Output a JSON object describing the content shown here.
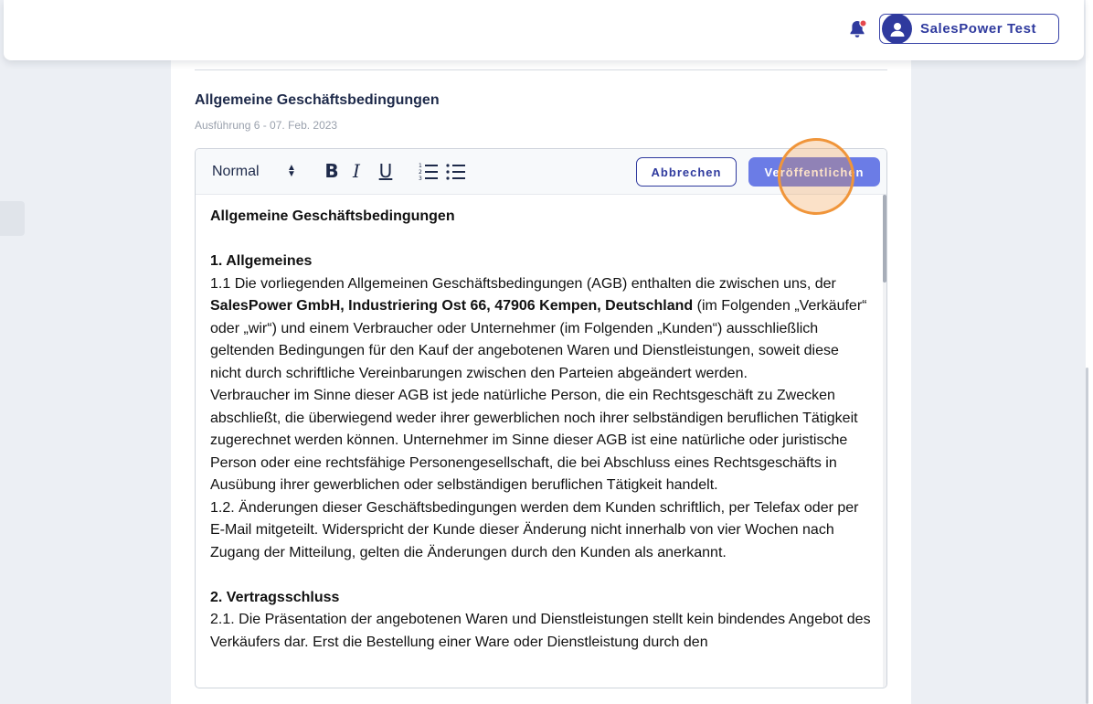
{
  "header": {
    "user_name": "SalesPower Test"
  },
  "document": {
    "title": "Allgemeine Geschäftsbedingungen",
    "subtitle": "Ausführung 6 - 07. Feb. 2023"
  },
  "toolbar": {
    "format_label": "Normal",
    "bold_label": "B",
    "italic_label": "I",
    "underline_label": "U",
    "cancel_label": "Abbrechen",
    "publish_label": "Veröffentlichen"
  },
  "content": {
    "heading": "Allgemeine Geschäftsbedingungen",
    "section1_title": "1. Allgemeines",
    "s1_p1_before": "1.1 Die vorliegenden Allgemeinen Geschäftsbedingungen (AGB) enthalten die zwischen uns, der ",
    "s1_p1_bold": "SalesPower GmbH, Industriering Ost 66, 47906 Kempen, Deutschland",
    "s1_p1_after": " (im Folgenden „Verkäufer“ oder „wir“) und einem Verbraucher oder Unternehmer (im Folgenden „Kunden“) ausschließlich geltenden Bedingungen für den Kauf der angebotenen Waren und Dienstleistungen, soweit diese nicht durch schriftliche Vereinbarungen zwischen den Parteien abgeändert werden.",
    "s1_p2": "Verbraucher im Sinne dieser AGB ist jede natürliche Person, die ein Rechtsgeschäft zu Zwecken abschließt, die überwiegend weder ihrer gewerblichen noch ihrer selbständigen beruflichen Tätigkeit zugerechnet werden können. Unternehmer im Sinne dieser AGB ist eine natürliche oder juristische Person oder eine rechtsfähige Personengesellschaft, die bei Abschluss eines Rechtsgeschäfts in Ausübung ihrer gewerblichen oder selbständigen beruflichen Tätigkeit handelt.",
    "s1_p3": "1.2. Änderungen dieser Geschäftsbedingungen werden dem Kunden schriftlich, per Telefax oder per E-Mail mitgeteilt. Widerspricht der Kunde dieser Änderung nicht innerhalb von vier Wochen nach Zugang der Mitteilung, gelten die Änderungen durch den Kunden als anerkannt.",
    "section2_title": "2. Vertragsschluss",
    "s2_p1": "2.1. Die Präsentation der angebotenen Waren und Dienstleistungen stellt kein bindendes Angebot des Verkäufers dar. Erst die Bestellung einer Ware oder Dienstleistung durch den"
  },
  "colors": {
    "brand": "#2f3a9e",
    "publish_button": "#6b7ce6",
    "notification_dot": "#e5484d",
    "click_highlight": "#f0953a"
  }
}
